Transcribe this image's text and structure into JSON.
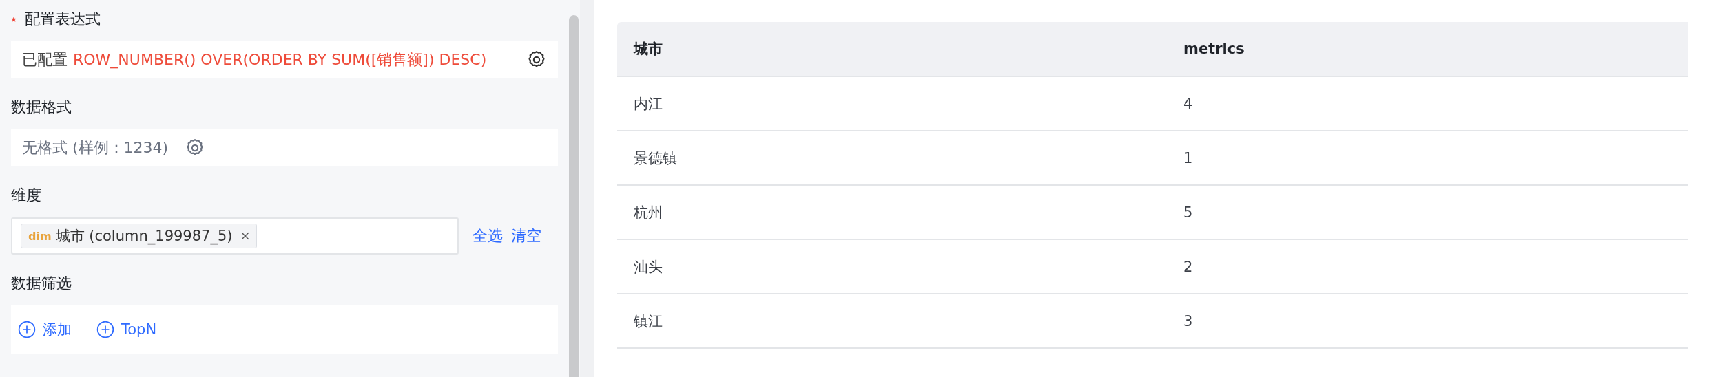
{
  "config": {
    "expression": {
      "label": "配置表达式",
      "required": true,
      "status": "已配置",
      "value": "ROW_NUMBER() OVER(ORDER BY SUM([销售额]) DESC)"
    },
    "format": {
      "label": "数据格式",
      "value": "无格式 (样例：1234)"
    },
    "dimension": {
      "label": "维度",
      "tags": [
        {
          "kind": "dim",
          "badge": "dim",
          "text": "城市 (column_199987_5)"
        }
      ],
      "actions": [
        "全选",
        "清空"
      ]
    },
    "filter": {
      "label": "数据筛选",
      "actions": [
        "添加",
        "TopN"
      ]
    }
  },
  "table": {
    "columns": [
      "城市",
      "metrics"
    ],
    "rows": [
      [
        "内江",
        "4"
      ],
      [
        "景德镇",
        "1"
      ],
      [
        "杭州",
        "5"
      ],
      [
        "汕头",
        "2"
      ],
      [
        "镇江",
        "3"
      ]
    ]
  }
}
